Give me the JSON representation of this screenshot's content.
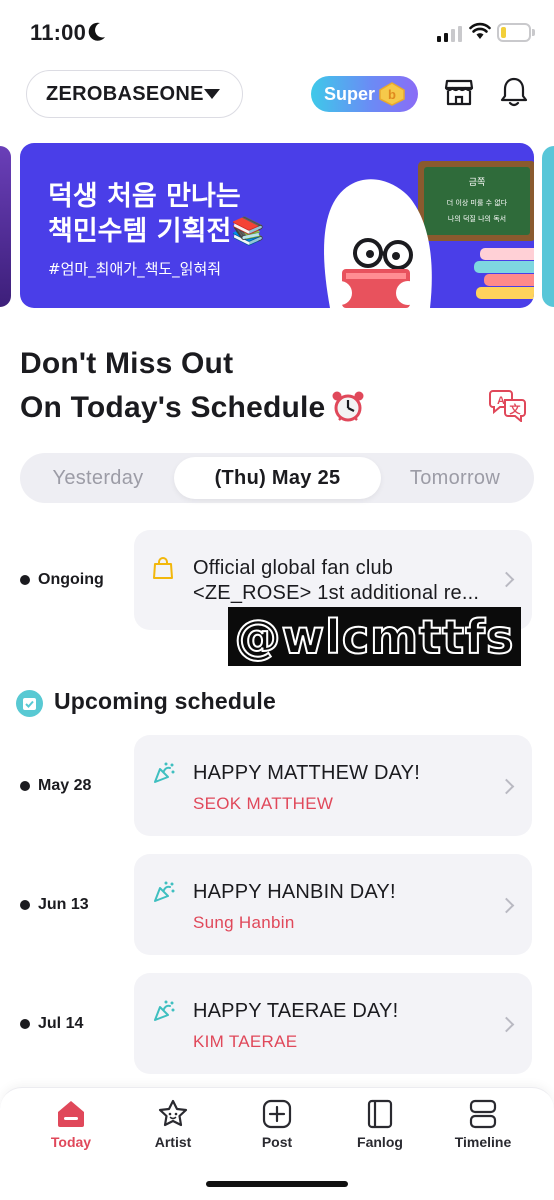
{
  "status_bar": {
    "time": "11:00"
  },
  "header": {
    "group_name": "ZEROBASEONE",
    "super_label": "Super"
  },
  "banner": {
    "title_line1": "덕생 처음 만나는",
    "title_line2": "책민수템 기획전📚",
    "hashtag": "#엄마_최애가_책도_읽혀줘",
    "chalk_line1": "금쪽",
    "chalk_line2": "더 이상 미룰 수 없다",
    "chalk_line3": "나의 덕질 나의 독서"
  },
  "schedule": {
    "title_line1": "Don't Miss Out",
    "title_line2": "On Today's Schedule",
    "tabs": {
      "yesterday": "Yesterday",
      "today": "(Thu) May 25",
      "tomorrow": "Tomorrow"
    },
    "ongoing": {
      "label": "Ongoing",
      "title_line1": "Official global fan club",
      "title_line2": "<ZE_ROSE> 1st additional re..."
    },
    "upcoming_title": "Upcoming schedule",
    "upcoming": [
      {
        "date": "May 28",
        "title": "HAPPY MATTHEW DAY!",
        "member": "SEOK MATTHEW"
      },
      {
        "date": "Jun 13",
        "title": "HAPPY HANBIN DAY!",
        "member": "Sung Hanbin"
      },
      {
        "date": "Jul 14",
        "title": "HAPPY TAERAE DAY!",
        "member": "KIM TAERAE"
      }
    ]
  },
  "watermark": "@wlcmttfs",
  "nav": {
    "today": "Today",
    "artist": "Artist",
    "post": "Post",
    "fanlog": "Fanlog",
    "timeline": "Timeline"
  },
  "colors": {
    "accent": "#e0485a",
    "banner_bg": "#4a3ee8",
    "card_bg": "#f3f3f7",
    "party_icon": "#3fbfc0"
  },
  "icons": [
    "moon-icon",
    "signal-icon",
    "wifi-icon",
    "battery-icon",
    "caret-down-icon",
    "b-coin-icon",
    "shop-icon",
    "bell-icon",
    "alarm-clock-icon",
    "translate-icon",
    "shopping-bag-icon",
    "party-popper-icon",
    "calendar-check-icon",
    "home-icon",
    "artist-star-icon",
    "post-plus-icon",
    "fanlog-book-icon",
    "timeline-icon"
  ]
}
